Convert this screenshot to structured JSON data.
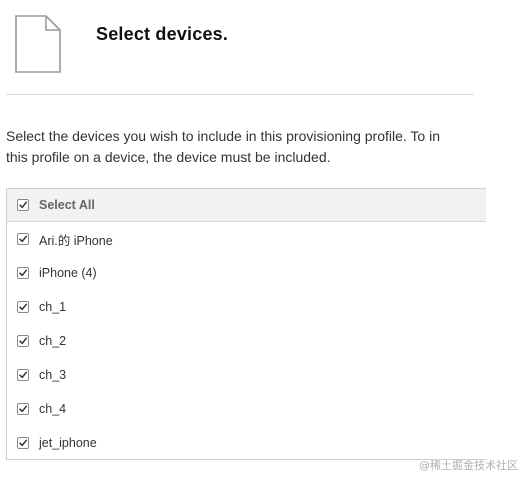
{
  "header": {
    "title": "Select devices.",
    "icon": "document-icon"
  },
  "description": {
    "line1": "Select the devices you wish to include in this provisioning profile. To in",
    "line2": "this profile on a device, the device must be included."
  },
  "device_list": {
    "select_all": {
      "label": "Select All",
      "checked": true
    },
    "devices": [
      {
        "label": "Ari.的 iPhone",
        "checked": true
      },
      {
        "label": "iPhone (4)",
        "checked": true
      },
      {
        "label": "ch_1",
        "checked": true
      },
      {
        "label": "ch_2",
        "checked": true
      },
      {
        "label": "ch_3",
        "checked": true
      },
      {
        "label": "ch_4",
        "checked": true
      },
      {
        "label": "jet_iphone",
        "checked": true
      }
    ]
  },
  "watermark": "@稀土掘金技术社区"
}
